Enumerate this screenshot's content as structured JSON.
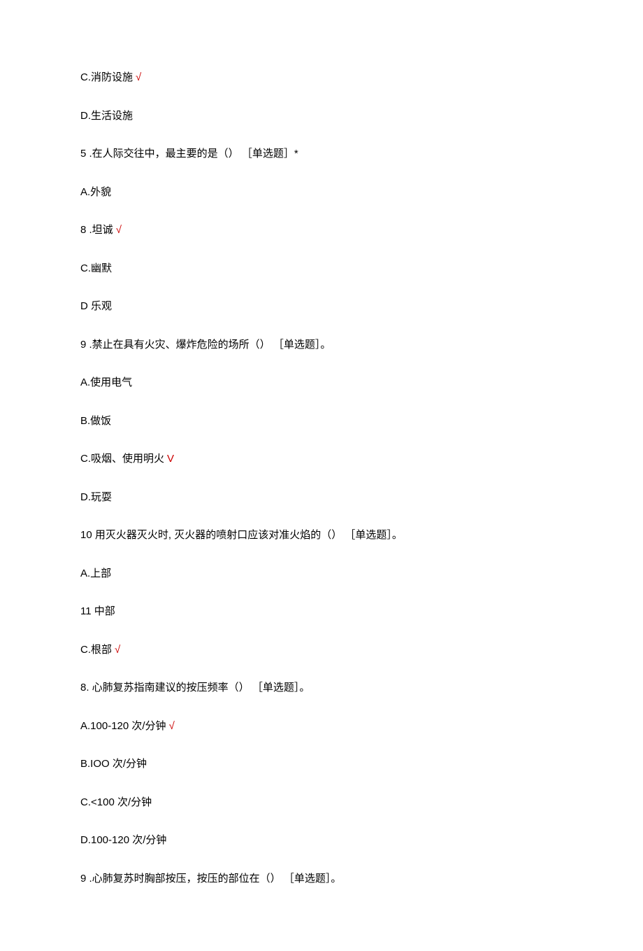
{
  "lines": [
    {
      "text": "C.消防设施",
      "check": "√"
    },
    {
      "text": "D.生活设施"
    },
    {
      "text": "5  .在人际交往中，最主要的是（） ［单选题］*"
    },
    {
      "text": "A.外貌"
    },
    {
      "text": "8  .坦诚",
      "check": "√"
    },
    {
      "text": "C.幽默"
    },
    {
      "text": "D 乐观"
    },
    {
      "text": "9  .禁止在具有火灾、爆炸危险的场所（） ［单选题］。"
    },
    {
      "text": "A.使用电气"
    },
    {
      "text": "B.做饭"
    },
    {
      "text": "C.吸烟、使用明火",
      "check": "V"
    },
    {
      "text": "D.玩耍"
    },
    {
      "text": "10  用灭火器灭火时, 灭火器的喷射口应该对准火焰的（） ［单选题］。"
    },
    {
      "text": "A.上部"
    },
    {
      "text": "11  中部"
    },
    {
      "text": "C.根部",
      "check": "√"
    },
    {
      "text": "8. 心肺复苏指南建议的按压频率（） ［单选题］。"
    },
    {
      "text": "A.100-120 次/分钟",
      "check": "√"
    },
    {
      "text": "B.IOO 次/分钟"
    },
    {
      "text": "C.<100 次/分钟"
    },
    {
      "text": "D.100-120 次/分钟"
    },
    {
      "text": "9  .心肺复苏时胸部按压，按压的部位在（） ［单选题］。"
    }
  ]
}
